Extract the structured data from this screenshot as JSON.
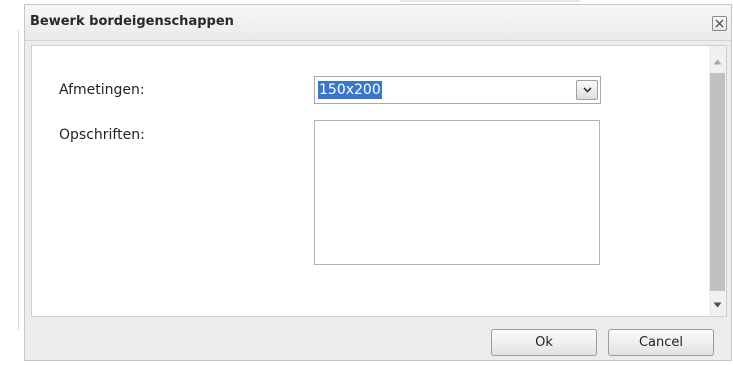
{
  "dialog": {
    "title": "Bewerk bordeigenschappen",
    "close_icon": "close-icon",
    "fields": {
      "dimensions_label": "Afmetingen:",
      "dimensions_value": "150x200",
      "captions_label": "Opschriften:",
      "captions_value": ""
    },
    "buttons": {
      "ok": "Ok",
      "cancel": "Cancel"
    }
  },
  "colors": {
    "selection": "#3a77cc",
    "dialog_bg": "#ececec"
  }
}
